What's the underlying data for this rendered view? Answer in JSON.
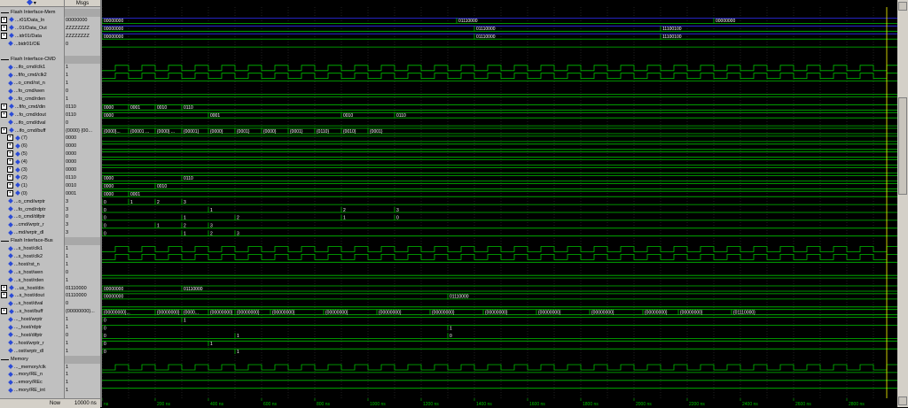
{
  "header": {
    "names_title": "",
    "values_title": "Msgs"
  },
  "groups": [
    {
      "label": "Flash Interface-Mem",
      "row": 0
    },
    {
      "label": "Flash Interface-CMD",
      "row": 6
    },
    {
      "label": "Flash Interface-Bus",
      "row": 29
    },
    {
      "label": "Memory",
      "row": 44
    }
  ],
  "signals": [
    {
      "name": "...r01/Data_In",
      "value": "00000000",
      "expand": true,
      "row": 1
    },
    {
      "name": "...01/Data_Out",
      "value": "ZZZZZZZZ",
      "expand": true,
      "row": 2
    },
    {
      "name": "...idr01/Data",
      "value": "ZZZZZZZZ",
      "expand": true,
      "row": 3
    },
    {
      "name": "...bidr01/OE",
      "value": "0",
      "expand": false,
      "row": 4
    },
    {
      "name": "...ifo_cmd/clk1",
      "value": "1",
      "expand": false,
      "row": 7
    },
    {
      "name": "...fifo_cmd/clk2",
      "value": "1",
      "expand": false,
      "row": 8
    },
    {
      "name": "...o_cmd/rst_n",
      "value": "1",
      "expand": false,
      "row": 9
    },
    {
      "name": "...fo_cmd/wen",
      "value": "0",
      "expand": false,
      "row": 10
    },
    {
      "name": "...fo_cmd/rden",
      "value": "1",
      "expand": false,
      "row": 11
    },
    {
      "name": "...fifo_cmd/din",
      "value": "0110",
      "expand": true,
      "row": 12
    },
    {
      "name": "...fo_cmd/dout",
      "value": "0110",
      "expand": true,
      "row": 13
    },
    {
      "name": "...ifo_cmd/dval",
      "value": "0",
      "expand": false,
      "row": 14
    },
    {
      "name": "...ifo_cmd/buff",
      "value": "{0000} {00...",
      "expand": true,
      "row": 15
    },
    {
      "name": "(7)",
      "value": "0000",
      "expand": true,
      "row": 16,
      "sub": true
    },
    {
      "name": "(6)",
      "value": "0000",
      "expand": true,
      "row": 17,
      "sub": true
    },
    {
      "name": "(5)",
      "value": "0000",
      "expand": true,
      "row": 18,
      "sub": true
    },
    {
      "name": "(4)",
      "value": "0000",
      "expand": true,
      "row": 19,
      "sub": true
    },
    {
      "name": "(3)",
      "value": "0000",
      "expand": true,
      "row": 20,
      "sub": true
    },
    {
      "name": "(2)",
      "value": "0110",
      "expand": true,
      "row": 21,
      "sub": true
    },
    {
      "name": "(1)",
      "value": "0010",
      "expand": true,
      "row": 22,
      "sub": true
    },
    {
      "name": "(0)",
      "value": "0001",
      "expand": true,
      "row": 23,
      "sub": true
    },
    {
      "name": "...o_cmd/wrptr",
      "value": "3",
      "expand": false,
      "row": 24
    },
    {
      "name": "...fo_cmd/rdptr",
      "value": "3",
      "expand": false,
      "row": 25
    },
    {
      "name": "...o_cmd/difptr",
      "value": "0",
      "expand": false,
      "row": 26
    },
    {
      "name": "...cmd/wrptr_r",
      "value": "3",
      "expand": false,
      "row": 27
    },
    {
      "name": "...md/wrptr_dl",
      "value": "3",
      "expand": false,
      "row": 28
    },
    {
      "name": "...s_host/clk1",
      "value": "1",
      "expand": false,
      "row": 30
    },
    {
      "name": "...s_host/clk2",
      "value": "1",
      "expand": false,
      "row": 31
    },
    {
      "name": "...host/rst_n",
      "value": "1",
      "expand": false,
      "row": 32
    },
    {
      "name": "...s_host/wen",
      "value": "0",
      "expand": false,
      "row": 33
    },
    {
      "name": "...s_host/rden",
      "value": "1",
      "expand": false,
      "row": 34
    },
    {
      "name": "...us_host/din",
      "value": "01110000",
      "expand": true,
      "row": 35
    },
    {
      "name": "...s_host/dout",
      "value": "01110000",
      "expand": true,
      "row": 36
    },
    {
      "name": "...s_host/dval",
      "value": "0",
      "expand": false,
      "row": 37
    },
    {
      "name": "...s_host/buff",
      "value": "{00000000}...",
      "expand": true,
      "row": 38
    },
    {
      "name": "..._host/wrptr",
      "value": "1",
      "expand": false,
      "row": 39
    },
    {
      "name": "..._host/rdptr",
      "value": "1",
      "expand": false,
      "row": 40
    },
    {
      "name": "..._host/difptr",
      "value": "0",
      "expand": false,
      "row": 41
    },
    {
      "name": "...host/wrptr_r",
      "value": "1",
      "expand": false,
      "row": 42
    },
    {
      "name": "...ost/wrptr_dl",
      "value": "1",
      "expand": false,
      "row": 43
    },
    {
      "name": "..._memory/clk",
      "value": "1",
      "expand": false,
      "row": 45
    },
    {
      "name": "...mory/RE_n",
      "value": "1",
      "expand": false,
      "row": 46
    },
    {
      "name": "...emory/REc",
      "value": "1",
      "expand": false,
      "row": 47
    },
    {
      "name": "...mory/RE_int",
      "value": "1",
      "expand": false,
      "row": 48
    }
  ],
  "bus_labels": [
    {
      "row": 1,
      "items": [
        [
          "00000000",
          0
        ],
        [
          "01110000",
          400
        ],
        [
          "00000000",
          690
        ]
      ]
    },
    {
      "row": 2,
      "items": [
        [
          "00000000",
          0
        ],
        [
          "01110000",
          420
        ],
        [
          "11100100",
          630
        ]
      ]
    },
    {
      "row": 3,
      "items": [
        [
          "00000000",
          0
        ],
        [
          "01110000",
          420
        ],
        [
          "11100100",
          630
        ]
      ]
    },
    {
      "row": 12,
      "items": [
        [
          "0000",
          0
        ],
        [
          "0001",
          30
        ],
        [
          "0010",
          60
        ],
        [
          "0110",
          90
        ]
      ]
    },
    {
      "row": 13,
      "items": [
        [
          "0000",
          0
        ],
        [
          "0001",
          120
        ],
        [
          "0010",
          270
        ],
        [
          "0110",
          330
        ]
      ]
    },
    {
      "row": 15,
      "items": [
        [
          "{0000}...",
          0
        ],
        [
          "{00001 ...",
          30
        ],
        [
          "{0000} ...",
          60
        ],
        [
          "{00001}",
          90
        ],
        [
          "{0000}",
          120
        ],
        [
          "{0001}",
          150
        ],
        [
          "{0000}",
          180
        ],
        [
          "{0001}",
          210
        ],
        [
          "{0110}",
          240
        ],
        [
          "{0010}",
          270
        ],
        [
          "{0001}",
          300
        ]
      ]
    },
    {
      "row": 21,
      "items": [
        [
          "0000",
          0
        ],
        [
          "0110",
          90
        ]
      ]
    },
    {
      "row": 22,
      "items": [
        [
          "0000",
          0
        ],
        [
          "0010",
          60
        ]
      ]
    },
    {
      "row": 23,
      "items": [
        [
          "0000",
          0
        ],
        [
          "0001",
          30
        ]
      ]
    },
    {
      "row": 24,
      "items": [
        [
          "0",
          0
        ],
        [
          "1",
          30
        ],
        [
          "2",
          60
        ],
        [
          "3",
          90
        ]
      ]
    },
    {
      "row": 25,
      "items": [
        [
          "0",
          0
        ],
        [
          "1",
          120
        ],
        [
          "2",
          270
        ],
        [
          "3",
          330
        ]
      ]
    },
    {
      "row": 26,
      "items": [
        [
          "0",
          0
        ],
        [
          "1",
          90
        ],
        [
          "2",
          150
        ],
        [
          "1",
          270
        ],
        [
          "0",
          330
        ]
      ]
    },
    {
      "row": 27,
      "items": [
        [
          "0",
          0
        ],
        [
          "1",
          60
        ],
        [
          "2",
          90
        ],
        [
          "3",
          120
        ]
      ]
    },
    {
      "row": 28,
      "items": [
        [
          "0",
          0
        ],
        [
          "1",
          90
        ],
        [
          "2",
          120
        ],
        [
          "3",
          150
        ]
      ]
    },
    {
      "row": 35,
      "items": [
        [
          "00000000",
          0
        ],
        [
          "01110000",
          90
        ]
      ]
    },
    {
      "row": 36,
      "items": [
        [
          "00000000",
          0
        ],
        [
          "01110000",
          390
        ]
      ]
    },
    {
      "row": 38,
      "items": [
        [
          "{00000000}...",
          0
        ],
        [
          "{00000000}",
          60
        ],
        [
          "{0000...",
          90
        ],
        [
          "{00000000}",
          120
        ],
        [
          "{00000000}",
          150
        ],
        [
          "{00000000}",
          190
        ],
        [
          "{00000000}",
          250
        ],
        [
          "{00000000}",
          310
        ],
        [
          "{00000000}",
          370
        ],
        [
          "{00000000}",
          430
        ],
        [
          "{00000000}",
          490
        ],
        [
          "{00000000}",
          550
        ],
        [
          "{00000000}",
          610
        ],
        [
          "{00000000}",
          650
        ],
        [
          "{01110000}",
          710
        ]
      ]
    },
    {
      "row": 39,
      "items": [
        [
          "0",
          0
        ],
        [
          "1",
          90
        ]
      ]
    },
    {
      "row": 40,
      "items": [
        [
          "0",
          0
        ],
        [
          "1",
          390
        ]
      ]
    },
    {
      "row": 41,
      "items": [
        [
          "0",
          0
        ],
        [
          "1",
          150
        ],
        [
          "0",
          390
        ]
      ]
    },
    {
      "row": 42,
      "items": [
        [
          "0",
          0
        ],
        [
          "1",
          120
        ]
      ]
    },
    {
      "row": 43,
      "items": [
        [
          "0",
          0
        ],
        [
          "1",
          150
        ]
      ]
    }
  ],
  "now": {
    "label": "Now",
    "value": "10000 ns"
  },
  "time_ticks": [
    "ns",
    "200 ns",
    "400 ns",
    "600 ns",
    "800 ns",
    "1000 ns",
    "1200 ns",
    "1400 ns",
    "1600 ns",
    "1800 ns",
    "2000 ns",
    "2200 ns",
    "2400 ns",
    "2600 ns",
    "2800 ns"
  ],
  "time_ticks_full": [
    "ns",
    "2400 ns",
    "200 ns",
    "400 ns",
    "600 ns",
    "800 ns",
    "1000 ns",
    "1200 ns",
    "1400 ns",
    "1600 ns",
    "1800 ns",
    "2000 ns",
    "2200 ns",
    "2400 ns",
    "2600 ns",
    "2800 ns"
  ],
  "colors": {
    "wave": "#00c000",
    "bus_blue": "#3030ff",
    "cursor": "#ffff00",
    "grid": "#404040"
  }
}
